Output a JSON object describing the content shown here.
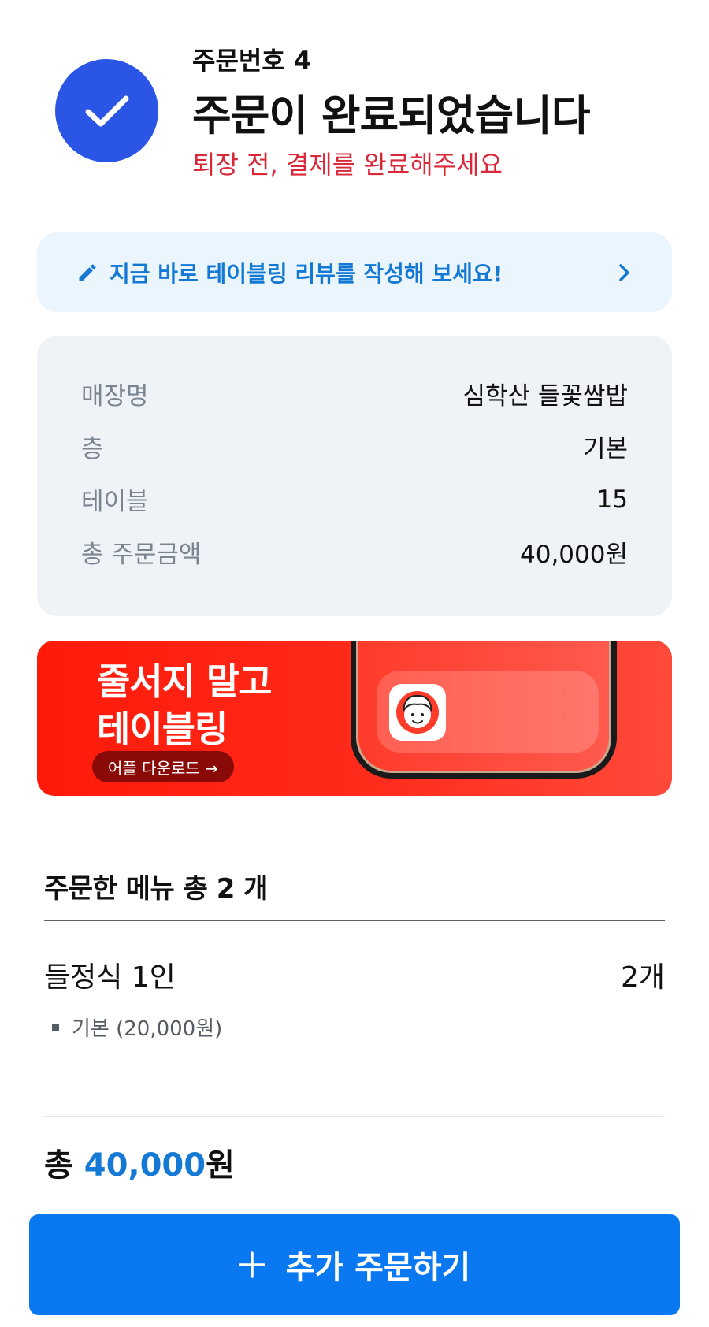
{
  "order": {
    "number_label": "주문번호 4",
    "title": "주문이 완료되었습니다",
    "subtitle": "퇴장 전, 결제를 완료해주세요"
  },
  "review_banner": {
    "text": "지금 바로 테이블링 리뷰를 작성해 보세요!"
  },
  "info": {
    "rows": [
      {
        "label": "매장명",
        "value": "심학산 들꽃쌈밥"
      },
      {
        "label": "층",
        "value": "기본"
      },
      {
        "label": "테이블",
        "value": "15"
      },
      {
        "label": "총 주문금액",
        "value": "40,000원"
      }
    ]
  },
  "promo": {
    "line1": "줄서지 말고",
    "line2": "테이블링",
    "button": "어플 다운로드 →"
  },
  "menu": {
    "header": "주문한 메뉴 총 2 개",
    "items": [
      {
        "name": "들정식 1인",
        "qty": "2개",
        "option": "기본 (20,000원)"
      }
    ]
  },
  "total": {
    "prefix": "총 ",
    "amount": "40,000",
    "suffix": "원"
  },
  "cta": {
    "label": "추가 주문하기"
  },
  "colors": {
    "primary": "#0a78f0",
    "check": "#2a55e5",
    "warning": "#d8283a",
    "link": "#1479d4",
    "promo": "#ff1a0a"
  }
}
